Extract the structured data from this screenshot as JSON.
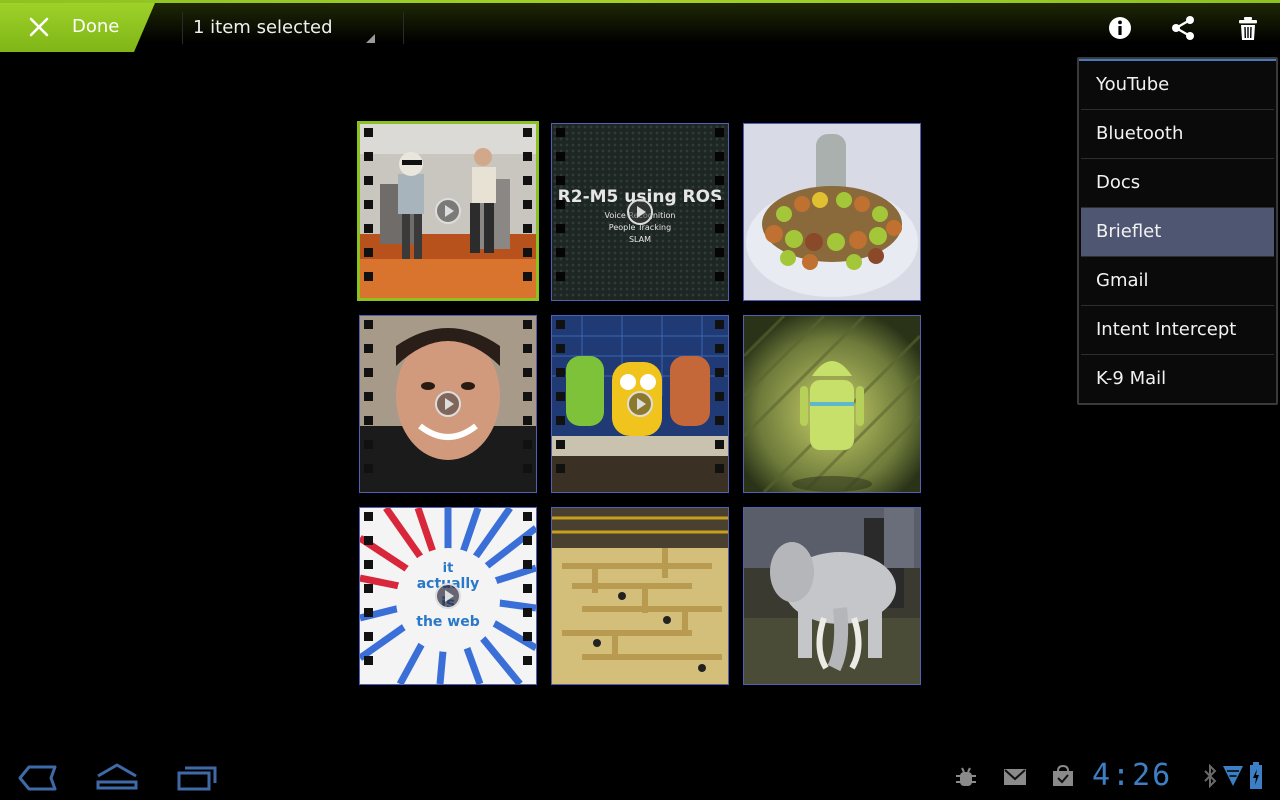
{
  "action_bar": {
    "done_label": "Done",
    "selection_text": "1 item selected",
    "icons": [
      "info-icon",
      "share-icon",
      "delete-icon"
    ]
  },
  "share_menu": {
    "items": [
      {
        "label": "YouTube"
      },
      {
        "label": "Bluetooth"
      },
      {
        "label": "Docs"
      },
      {
        "label": "Brieflet",
        "highlighted": true
      },
      {
        "label": "Gmail"
      },
      {
        "label": "Intent Intercept"
      },
      {
        "label": "K-9 Mail"
      }
    ]
  },
  "grid": {
    "items": [
      {
        "type": "video",
        "selected": true
      },
      {
        "type": "video",
        "title": "R2-M5 using ROS",
        "lines": [
          "Voice Recognition",
          "People Tracking",
          "SLAM"
        ]
      },
      {
        "type": "photo"
      },
      {
        "type": "video"
      },
      {
        "type": "video"
      },
      {
        "type": "photo"
      },
      {
        "type": "video",
        "text": [
          "it",
          "actually",
          "is",
          "the web"
        ]
      },
      {
        "type": "photo"
      },
      {
        "type": "photo"
      }
    ]
  },
  "status_bar": {
    "time": "4:26",
    "icons": [
      "debug-icon",
      "gmail-icon",
      "market-icon",
      "bluetooth-icon",
      "wifi-icon",
      "battery-icon"
    ]
  },
  "nav_bar": {
    "icons": [
      "back-icon",
      "home-icon",
      "recent-apps-icon"
    ]
  },
  "colors": {
    "accent_green": "#8cc21f",
    "selection_blue": "#4f5671",
    "clock_blue": "#3d7fc4"
  }
}
